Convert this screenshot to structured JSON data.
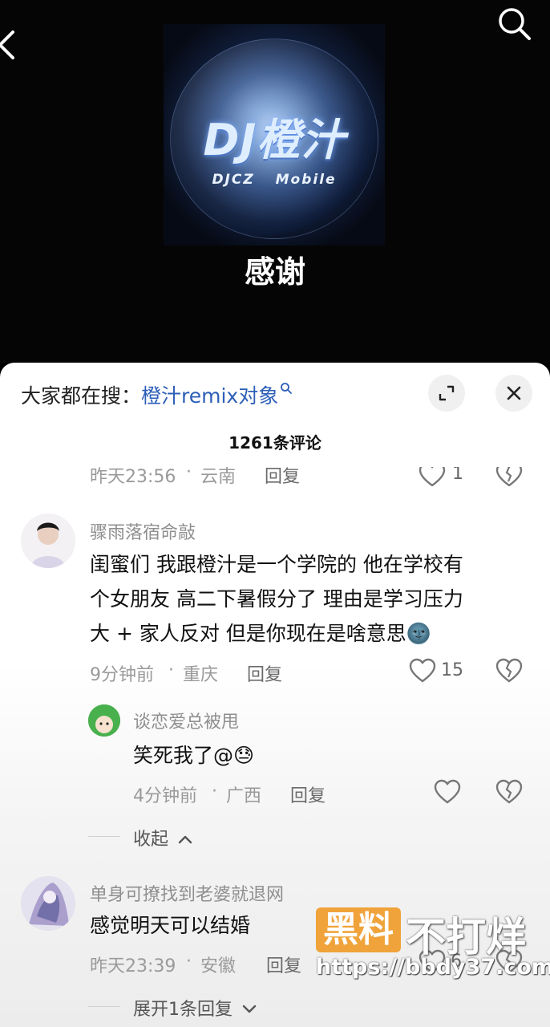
{
  "song": {
    "cover_brand": "DJ橙汁",
    "cover_sub": "DJCZ Mobile",
    "title": "感谢"
  },
  "sheet": {
    "hot_prefix": "大家都在搜：",
    "hot_keyword": "橙汁remix对象",
    "comment_count": "1261条评论"
  },
  "partial_comment": {
    "time": "昨天23:56",
    "location": "云南",
    "reply": "回复",
    "likes": "1"
  },
  "comments": [
    {
      "username": "骤雨落宿命敲",
      "lines": [
        "闺蜜们 我跟橙汁是一个学院的 他在学校有",
        "个女朋友 高二下暑假分了 理由是学习压力",
        "大 + 家人反对 但是你现在是啥意思🌚"
      ],
      "time": "9分钟前",
      "location": "重庆",
      "reply": "回复",
      "likes": "15"
    },
    {
      "username": "谈恋爱总被甩",
      "text": "笑死我了@😓",
      "time": "4分钟前",
      "location": "广西",
      "reply": "回复",
      "likes": ""
    },
    {
      "username": "单身可撩找到老婆就退网",
      "text": "感觉明天可以结婚",
      "time": "昨天23:39",
      "location": "安徽",
      "reply": "回复",
      "likes": "6"
    }
  ],
  "collapse_label": "收起",
  "expand_label": "展开1条回复",
  "watermark": {
    "box": "黑料",
    "text": "不打烊",
    "url": "https://bbdy37.com"
  },
  "icons": {
    "back": "chevron-left-icon",
    "search": "search-icon",
    "expand": "expand-icon",
    "close": "close-icon",
    "like": "heart-icon",
    "dislike": "broken-heart-icon"
  },
  "colors": {
    "keyword": "#2d5fb8",
    "watermark_box": "#f0a33a"
  }
}
